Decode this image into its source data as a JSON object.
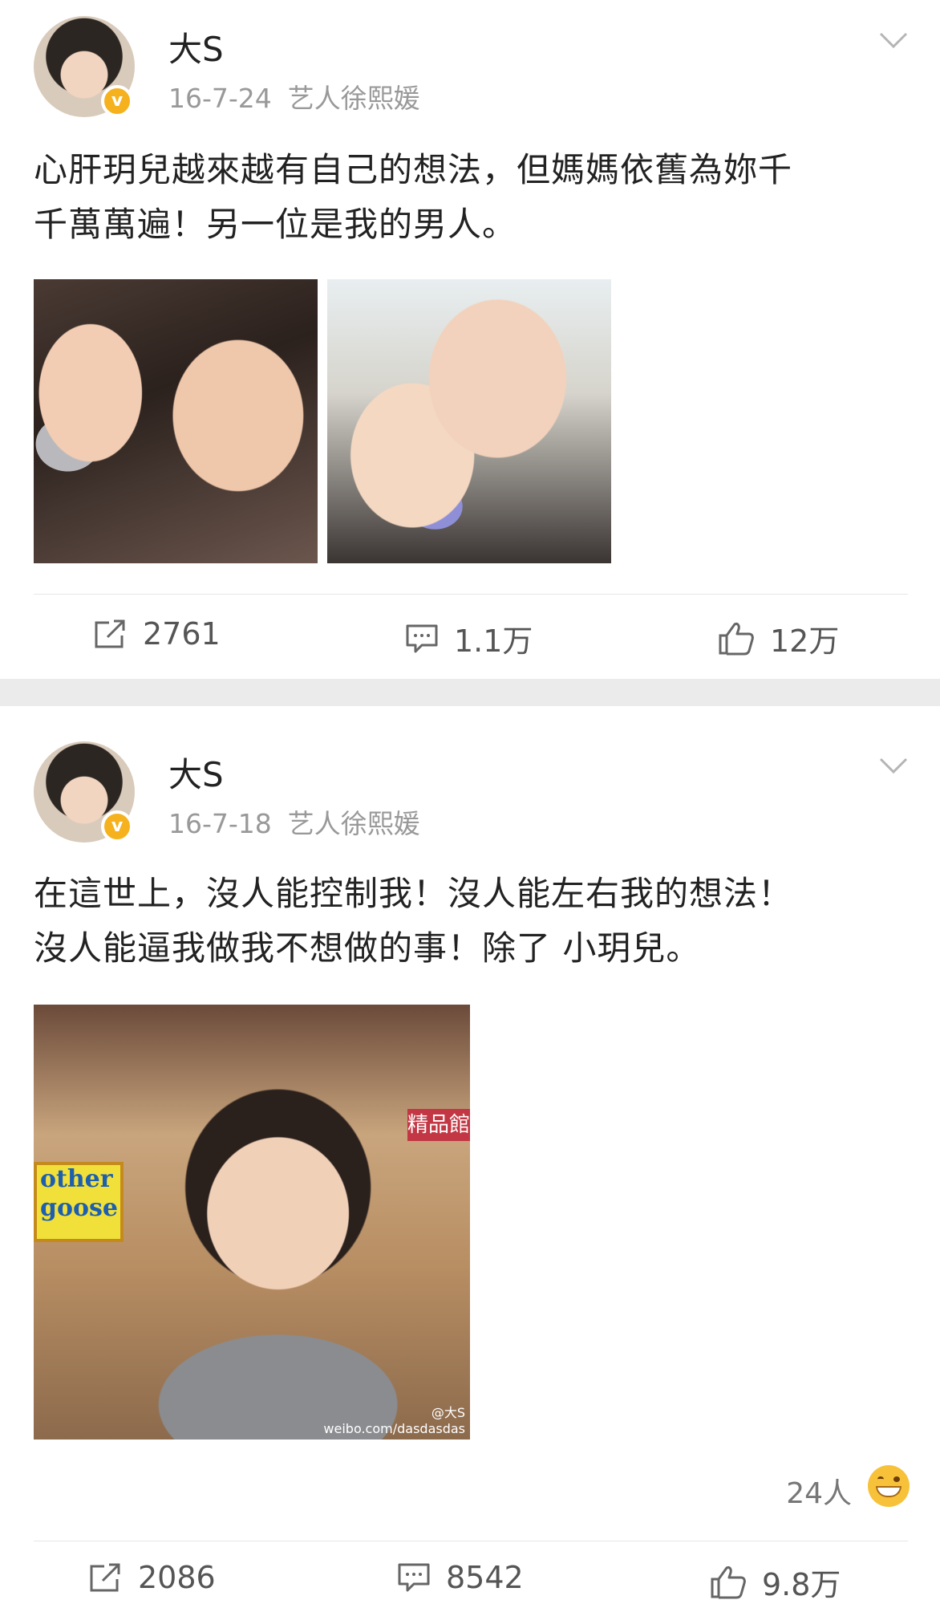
{
  "posts": [
    {
      "author": "大S",
      "date": "16-7-24",
      "source": "艺人徐熙媛",
      "text_line1": "心肝玥兒越來越有自己的想法，但媽媽依舊為妳千",
      "text_line2": "千萬萬遍！另一位是我的男人。",
      "reposts": "2761",
      "comments": "1.1万",
      "likes": "12万"
    },
    {
      "author": "大S",
      "date": "16-7-18",
      "source": "艺人徐熙媛",
      "text_line1": "在這世上，沒人能控制我！沒人能左右我的想法！",
      "text_line2": "沒人能逼我做我不想做的事！除了 小玥兒。",
      "image_sign": "other goose",
      "image_store": "精品館",
      "watermark_user": "@大S",
      "watermark_url": "weibo.com/dasdasdas",
      "likers": "24人",
      "reposts": "2086",
      "comments": "8542",
      "likes": "9.8万"
    }
  ],
  "icons": {
    "repost": "share-icon",
    "comment": "comment-icon",
    "like": "thumbs-up-icon",
    "menu": "chevron-down-icon",
    "verified": "verified-badge-icon",
    "emoji": "grinning-emoji-icon"
  },
  "colors": {
    "verified": "#f5b21e",
    "separator": "#ebebeb",
    "meta_text": "#999999"
  }
}
